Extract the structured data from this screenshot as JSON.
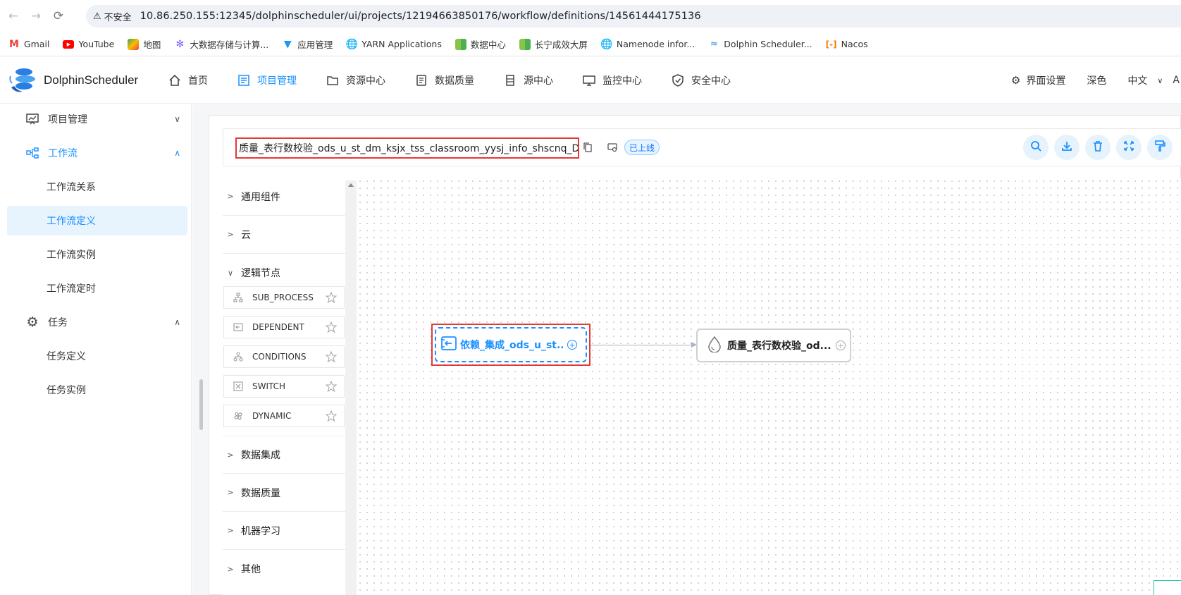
{
  "browser": {
    "security_label": "不安全",
    "url": "10.86.250.155:12345/dolphinscheduler/ui/projects/12194663850176/workflow/definitions/14561444175136",
    "bookmarks": [
      {
        "label": "Gmail",
        "icon": "gmail-icon",
        "color": "#ea4335"
      },
      {
        "label": "YouTube",
        "icon": "youtube-icon",
        "color": "#ff0000"
      },
      {
        "label": "地图",
        "icon": "maps-icon",
        "color": "#34a853"
      },
      {
        "label": "大数据存储与计算...",
        "icon": "bigdata-icon",
        "color": "#7b61ff"
      },
      {
        "label": "应用管理",
        "icon": "app-manage-icon",
        "color": "#2196f3"
      },
      {
        "label": "YARN Applications",
        "icon": "globe-icon",
        "color": "#555555"
      },
      {
        "label": "数据中心",
        "icon": "data-center-icon",
        "color": "#4caf50"
      },
      {
        "label": "长宁成效大屏",
        "icon": "screen-icon",
        "color": "#4caf50"
      },
      {
        "label": "Namenode infor...",
        "icon": "globe-icon",
        "color": "#555555"
      },
      {
        "label": "Dolphin Scheduler...",
        "icon": "dolphin-icon",
        "color": "#5aa0e6"
      },
      {
        "label": "Nacos",
        "icon": "nacos-icon",
        "color": "#f57c00"
      }
    ]
  },
  "header": {
    "logo_text": "DolphinScheduler",
    "nav": [
      {
        "label": "首页",
        "icon": "home-icon",
        "active": false
      },
      {
        "label": "项目管理",
        "icon": "project-icon",
        "active": true
      },
      {
        "label": "资源中心",
        "icon": "folder-icon",
        "active": false
      },
      {
        "label": "数据质量",
        "icon": "data-quality-icon",
        "active": false
      },
      {
        "label": "源中心",
        "icon": "datasource-icon",
        "active": false
      },
      {
        "label": "监控中心",
        "icon": "monitor-icon",
        "active": false
      },
      {
        "label": "安全中心",
        "icon": "shield-icon",
        "active": false
      }
    ],
    "ui_settings": "界面设置",
    "theme": "深色",
    "language": "中文",
    "user_initial": "A"
  },
  "sidebar": {
    "groups": [
      {
        "label": "项目管理",
        "expanded": false,
        "children": []
      },
      {
        "label": "工作流",
        "expanded": true,
        "children": [
          "工作流关系",
          "工作流定义",
          "工作流实例",
          "工作流定时"
        ]
      },
      {
        "label": "任务",
        "expanded": true,
        "children": [
          "任务定义",
          "任务实例"
        ]
      }
    ],
    "active_item": "工作流定义"
  },
  "toolbar": {
    "workflow_name": "质量_表行数校验_ods_u_st_dm_ksjx_tss_classroom_yysj_info_shscnq_D",
    "status_tag": "已上线"
  },
  "palette": {
    "categories": [
      "通用组件",
      "云",
      "逻辑节点",
      "数据集成",
      "数据质量",
      "机器学习",
      "其他"
    ],
    "logic_nodes": [
      "SUB_PROCESS",
      "DEPENDENT",
      "CONDITIONS",
      "SWITCH",
      "DYNAMIC"
    ]
  },
  "canvas": {
    "nodes": [
      {
        "label": "依赖_集成_ods_u_st..",
        "type": "DEPENDENT",
        "selected": true
      },
      {
        "label": "质量_表行数校验_od...",
        "type": "DATA_QUALITY",
        "selected": false
      }
    ]
  },
  "colors": {
    "accent": "#1890ff",
    "highlight": "#e53935"
  }
}
